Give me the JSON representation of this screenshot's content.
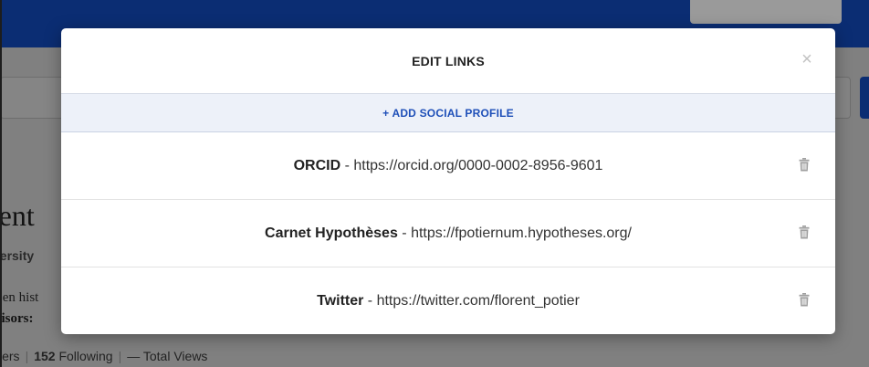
{
  "background": {
    "name_fragment": "rent",
    "university_fragment": "versity",
    "description_fragment": "r en hist",
    "advisors_fragment": "visors:",
    "stats": {
      "followers_label": "wers",
      "following_count": "152",
      "following_label": "Following",
      "total_views_value": "—",
      "total_views_label": "Total Views"
    }
  },
  "modal": {
    "title": "EDIT LINKS",
    "close_glyph": "×",
    "add_button_label": "+ ADD SOCIAL PROFILE",
    "links": [
      {
        "site": "ORCID",
        "separator": " - ",
        "url": "https://orcid.org/0000-0002-8956-9601"
      },
      {
        "site": "Carnet Hypothèses",
        "separator": " - ",
        "url": "https://fpotiernum.hypotheses.org/"
      },
      {
        "site": "Twitter",
        "separator": " - ",
        "url": "https://twitter.com/florent_potier"
      }
    ],
    "delete_icon": "trash-icon"
  },
  "colors": {
    "topbar": "#0b2d73",
    "overlay": "#808080",
    "accent_blue": "#1e4fb8",
    "add_row_bg": "#edf1f9",
    "icon_grey": "#a0a0a0"
  }
}
